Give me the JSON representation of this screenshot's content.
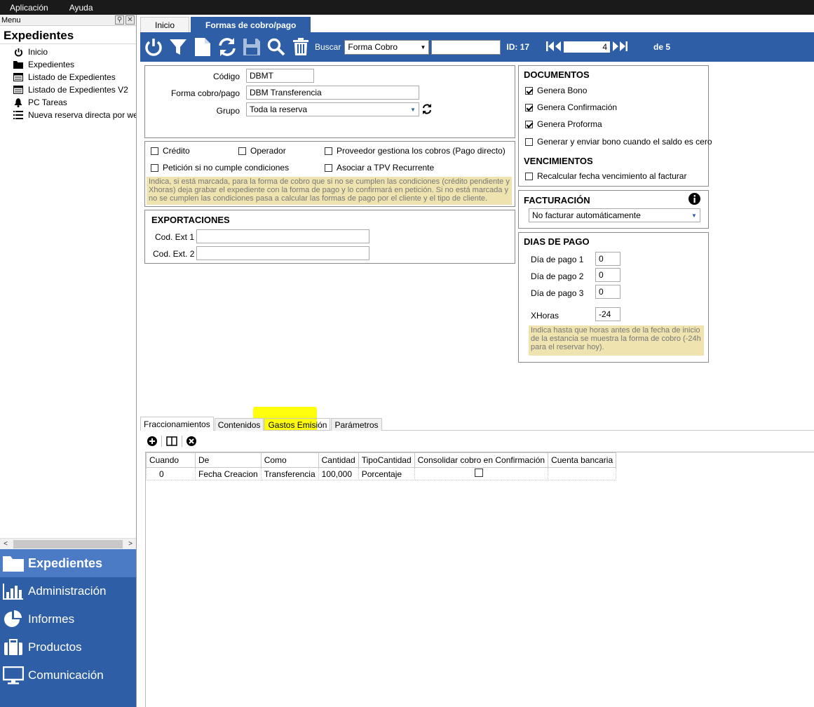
{
  "menubar": {
    "items": [
      "Aplicación",
      "Ayuda"
    ]
  },
  "sidebar": {
    "pane_label": "Menu",
    "title": "Expedientes",
    "items": [
      {
        "label": "Inicio",
        "icon": "power-icon"
      },
      {
        "label": "Expedientes",
        "icon": "folder-icon"
      },
      {
        "label": "Listado de Expedientes",
        "icon": "list-icon"
      },
      {
        "label": "Listado de Expedientes V2",
        "icon": "list-icon"
      },
      {
        "label": "PC Tareas",
        "icon": "bell-icon"
      },
      {
        "label": "Nueva reserva directa por we",
        "icon": "list-lines-icon"
      }
    ],
    "nav": [
      {
        "label": "Expedientes",
        "icon": "folder-icon",
        "active": true
      },
      {
        "label": "Administración",
        "icon": "bar-chart-icon"
      },
      {
        "label": "Informes",
        "icon": "pie-chart-icon"
      },
      {
        "label": "Productos",
        "icon": "briefcase-icon"
      },
      {
        "label": "Comunicación",
        "icon": "monitor-icon"
      }
    ]
  },
  "tabs": [
    "Inicio",
    "Formas de cobro/pago"
  ],
  "toolbar": {
    "buscar_label": "Buscar",
    "buscar_select": "Forma Cobro",
    "id_label": "ID: 17",
    "page": "4",
    "de_label": "de 5"
  },
  "form": {
    "codigo_label": "Código",
    "codigo_value": "DBMT",
    "forma_label": "Forma cobro/pago",
    "forma_value": "DBM Transferencia",
    "grupo_label": "Grupo",
    "grupo_value": "Toda la reserva",
    "credito": "Crédito",
    "operador": "Operador",
    "proveedor": "Proveedor gestiona los cobros (Pago directo)",
    "peticion": "Petición si no cumple condiciones",
    "tpv": "Asociar a TPV Recurrente",
    "peticion_note": "Indica, si está marcada, para la forma de cobro que si no se cumplen las condiciones (crédito pendiente y Xhoras) deja grabar el expediente con la forma de pago y lo confirmará en petición. Si no está marcada y no se cumplen las condiciones pasa a calcular las formas de pago por el cliente y el tipo de cliente.",
    "exportaciones_title": "EXPORTACIONES",
    "cod_ext1_label": "Cod. Ext 1",
    "cod_ext2_label": "Cod. Ext. 2"
  },
  "documentos": {
    "title": "DOCUMENTOS",
    "genera_bono": "Genera Bono",
    "genera_confirmacion": "Genera Confirmación",
    "genera_proforma": "Genera Proforma",
    "generar_enviar": "Generar y enviar bono cuando el saldo es cero",
    "vencimientos_title": "VENCIMIENTOS",
    "recalcular": "Recalcular fecha vencimiento al facturar"
  },
  "facturacion": {
    "title": "FACTURACIÓN",
    "value": "No facturar automáticamente"
  },
  "dias_pago": {
    "title": "DIAS DE PAGO",
    "dia1_label": "Día de pago 1",
    "dia1_value": "0",
    "dia2_label": "Día de pago 2",
    "dia2_value": "0",
    "dia3_label": "Día de pago 3",
    "dia3_value": "0",
    "xhoras_label": "XHoras",
    "xhoras_value": "-24",
    "xhoras_note": "Indica hasta que horas antes de la fecha de inicio de la estancia se muestra la forma de cobro (-24h para el reservar hoy)."
  },
  "bottom_tabs": [
    "Fraccionamientos",
    "Contenidos",
    "Gastos Emisión",
    "Parámetros"
  ],
  "grid": {
    "columns": [
      "Cuando",
      "De",
      "Como",
      "Cantidad",
      "TipoCantidad",
      "Consolidar cobro en Confirmación",
      "Cuenta bancaria"
    ],
    "rows": [
      [
        "0",
        "Fecha Creacion",
        "Transferencia",
        "100,000",
        "Porcentaje",
        "",
        ""
      ]
    ]
  },
  "colors": {
    "brand_blue": "#2d5ea6",
    "nav_active": "#4a7bc4",
    "note_bg": "#efe4b0",
    "highlight": "#ffff00"
  }
}
